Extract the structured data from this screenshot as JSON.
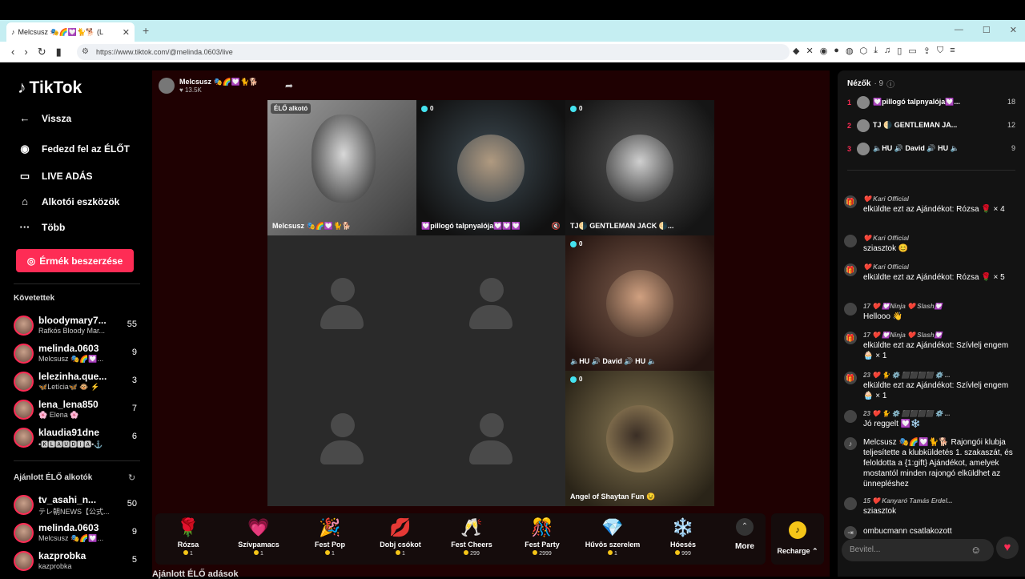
{
  "browser": {
    "tab_title": "Melcsusz 🎭🌈💟🐈🐕 (L",
    "tab_close": "✕",
    "newtab": "+",
    "url": "https://www.tiktok.com/@melinda.0603/live",
    "win": [
      "—",
      "☐",
      "✕"
    ]
  },
  "sidebar": {
    "logo": "TikTok",
    "back": "Vissza",
    "explore": "Fedezd fel az ÉLŐT",
    "live": "LIVE ADÁS",
    "creator_tools": "Alkotói eszközök",
    "more": "Több",
    "coins": "Érmék beszerzése",
    "following_title": "Követettek",
    "following": [
      {
        "name": "bloodymary7...",
        "sub": "Rafkós Bloody Mar...",
        "count": "55"
      },
      {
        "name": "melinda.0603",
        "sub": "Melcsusz 🎭🌈💟...",
        "count": "9"
      },
      {
        "name": "lelezinha.que...",
        "sub": "🦋Letícia🦋 🐵 ⚡",
        "count": "3"
      },
      {
        "name": "lena_lena850",
        "sub": "🌸 Elena 🌸",
        "count": "7"
      },
      {
        "name": "klaudia91dne",
        "sub": "•🅺🅻🅰🆄🅳🅸🅰•⚓",
        "count": "6"
      }
    ],
    "recommended_title": "Ajánlott ÉLŐ alkotók",
    "recommended": [
      {
        "name": "tv_asahi_n...",
        "sub": "テレ朝NEWS【公式...",
        "count": "50"
      },
      {
        "name": "melinda.0603",
        "sub": "Melcsusz 🎭🌈💟...",
        "count": "9"
      },
      {
        "name": "kazprobka",
        "sub": "kazprobka",
        "count": "5"
      }
    ]
  },
  "live": {
    "host_name": "Melcsusz 🎭🌈💟🐈🐕",
    "host_likes": "♥ 13.5K",
    "host_label": "ÉLŐ alkotó",
    "host_cell_name": "Melcsusz 🎭🌈💟🐈🐕",
    "guests": [
      {
        "score": "0",
        "name": "💟pillogó talpnyalója💟💟💟"
      },
      {
        "score": "0",
        "name": "TJ🌗 GENTLEMAN JACK 🌗..."
      },
      {
        "score": "0",
        "name": "🔈HU 🔊 David 🔊 HU 🔈"
      },
      {
        "score": "0",
        "name": "Angel of Shaytan Fun 😉"
      }
    ],
    "gifts": [
      {
        "name": "Rózsa",
        "price": "1",
        "icon": "🌹"
      },
      {
        "name": "Szívpamacs",
        "price": "1",
        "icon": "💗"
      },
      {
        "name": "Fest Pop",
        "price": "1",
        "icon": "🎉"
      },
      {
        "name": "Dobj csókot",
        "price": "1",
        "icon": "💋"
      },
      {
        "name": "Fest Cheers",
        "price": "299",
        "icon": "🥂"
      },
      {
        "name": "Fest Party",
        "price": "2999",
        "icon": "🎊"
      },
      {
        "name": "Hűvös szerelem",
        "price": "1",
        "icon": "💎"
      },
      {
        "name": "Hóesés",
        "price": "999",
        "icon": "❄️"
      }
    ],
    "more": "More",
    "recharge": "Recharge",
    "recommended_below": "Ajánlott ÉLŐ adások"
  },
  "chat": {
    "viewers_title": "Nézők",
    "viewers_count": "· 9",
    "top_viewers": [
      {
        "rank": "1",
        "name": "💟pillogó talpnyalója💟...",
        "score": "18"
      },
      {
        "rank": "2",
        "name": "TJ 🌗 GENTLEMAN JA...",
        "score": "12"
      },
      {
        "rank": "3",
        "name": "🔈HU 🔊 David 🔊 HU 🔈",
        "score": "9"
      }
    ],
    "messages": [
      {
        "user": "❤️ Kari Official",
        "text": "elküldte ezt az Ajándékot: Rózsa 🌹 × 4"
      },
      {
        "user": "❤️ Kari Official",
        "text": "sziasztok 😊"
      },
      {
        "user": "❤️ Kari Official",
        "text": "elküldte ezt az Ajándékot: Rózsa 🌹 × 5"
      },
      {
        "user": "17 ❤️ 💟Ninja ❤️ Slash💟",
        "text": "Hellooo 👋"
      },
      {
        "user": "17 ❤️ 💟Ninja ❤️ Slash💟",
        "text": "elküldte ezt az Ajándékot: Szívlelj engem 🧁 × 1"
      },
      {
        "user": "23 ❤️ 🐈 ⚙️ ⬛⬛⬛⬛ ⚙️ ...",
        "text": "elküldte ezt az Ajándékot: Szívlelj engem 🧁 × 1"
      },
      {
        "user": "23 ❤️ 🐈 ⚙️ ⬛⬛⬛⬛ ⚙️ ...",
        "text": "Jó reggelt 💟❄️"
      },
      {
        "user": "",
        "text": "Melcsusz 🎭🌈💟🐈🐕 Rajongói klubja teljesítette a klubküldetés 1. szakaszát, és feloldotta a {1:gift} Ajándékot, amelyek mostantól minden rajongó elküldhet az ünnepléshez"
      },
      {
        "user": "15 ❤️ Kanyaró Tamás Erdel...",
        "text": "sziasztok"
      },
      {
        "user": "",
        "text": "ombucmann   csatlakozott"
      }
    ],
    "input_placeholder": "Bevitel..."
  }
}
